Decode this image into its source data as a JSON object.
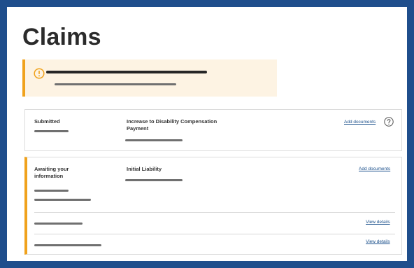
{
  "page": {
    "title": "Claims"
  },
  "alert": {
    "icon": "warning-circle-icon",
    "accent_color": "#f0a21c",
    "background_color": "#fdf3e3"
  },
  "claims": [
    {
      "status": "Submitted",
      "claim_type": "Increase to Disability Compensation Payment",
      "action_label": "Add documents",
      "help_icon": "question-circle-icon"
    },
    {
      "status": "Awaiting your information",
      "claim_type": "Initial Liability",
      "action_label": "Add documents",
      "items": [
        {
          "action_label": "View details"
        },
        {
          "action_label": "View details"
        }
      ]
    }
  ],
  "colors": {
    "header_band": "#1f4e8c",
    "link": "#1a4f8b",
    "warning_accent": "#f0a21c"
  }
}
